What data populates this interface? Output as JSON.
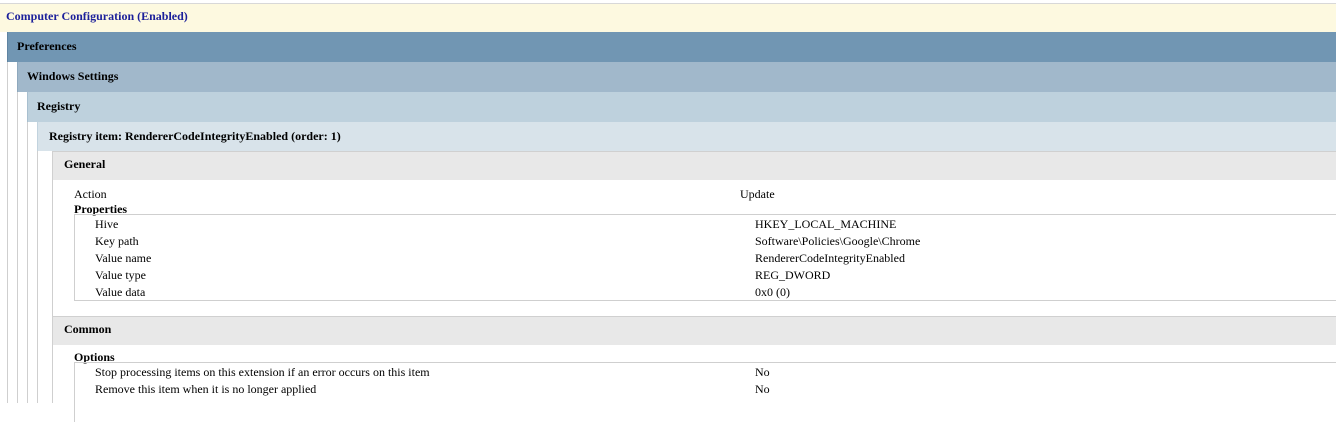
{
  "header": {
    "title": "Computer Configuration (Enabled)"
  },
  "tree": {
    "level1": "Preferences",
    "level2": "Windows Settings",
    "level3": "Registry",
    "level4": "Registry item: RendererCodeIntegrityEnabled (order: 1)"
  },
  "general": {
    "heading": "General",
    "action": {
      "label": "Action",
      "value": "Update"
    },
    "properties_heading": "Properties",
    "properties": [
      {
        "label": "Hive",
        "value": "HKEY_LOCAL_MACHINE"
      },
      {
        "label": "Key path",
        "value": "Software\\Policies\\Google\\Chrome"
      },
      {
        "label": "Value name",
        "value": "RendererCodeIntegrityEnabled"
      },
      {
        "label": "Value type",
        "value": "REG_DWORD"
      },
      {
        "label": "Value data",
        "value": "0x0 (0)"
      }
    ]
  },
  "common": {
    "heading": "Common",
    "options_heading": "Options",
    "options": [
      {
        "label": "Stop processing items on this extension if an error occurs on this item",
        "value": "No"
      },
      {
        "label": "Remove this item when it is no longer applied",
        "value": "No"
      }
    ]
  }
}
